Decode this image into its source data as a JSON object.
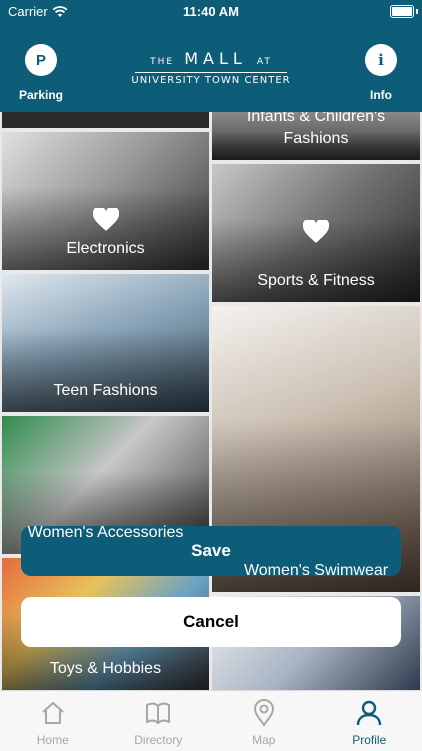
{
  "status": {
    "carrier": "Carrier",
    "time": "11:40 AM"
  },
  "header": {
    "parking_icon": "P",
    "parking_label": "Parking",
    "logo_the": "THE",
    "logo_mall": "MALL",
    "logo_at": "AT",
    "logo_sub": "UNIVERSITY TOWN CENTER",
    "info_icon": "i",
    "info_label": "Info"
  },
  "categories": [
    {
      "label": "Infants  & Children's Fashions",
      "favorite": false
    },
    {
      "label": "Electronics",
      "favorite": true
    },
    {
      "label": "Sports & Fitness",
      "favorite": true
    },
    {
      "label": "Teen Fashions",
      "favorite": false
    },
    {
      "label": "Women's Accessories",
      "favorite": false
    },
    {
      "label": "Women's Swimwear",
      "favorite": false
    },
    {
      "label": "Toys & Hobbies",
      "favorite": false
    }
  ],
  "sheet": {
    "save_label": "Save",
    "cancel_label": "Cancel"
  },
  "tabs": [
    {
      "label": "Home",
      "icon": "home-icon"
    },
    {
      "label": "Directory",
      "icon": "book-icon"
    },
    {
      "label": "Map",
      "icon": "map-pin-icon"
    },
    {
      "label": "Profile",
      "icon": "person-icon",
      "active": true
    }
  ],
  "colors": {
    "brand": "#0d5c78",
    "inactive_tab": "#a7a7a7",
    "sheet_bg": "#ffffff"
  }
}
